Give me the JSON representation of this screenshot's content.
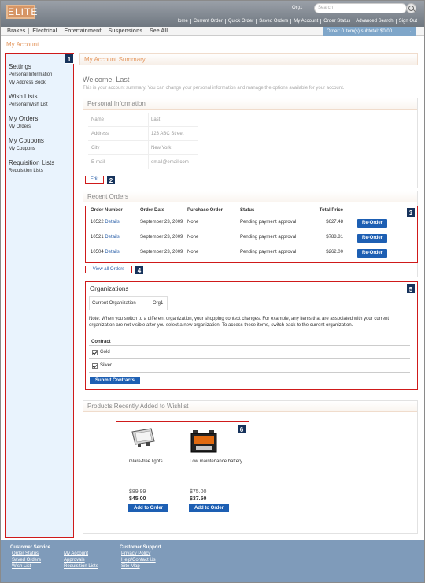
{
  "header": {
    "logo": "ELITE",
    "org": "Org1",
    "search_placeholder": "Search",
    "nav": [
      "Home",
      "Current Order",
      "Quick Order",
      "Saved Orders",
      "My Account",
      "Order Status",
      "Advanced Search",
      "Sign Out"
    ]
  },
  "catbar": {
    "categories": [
      "Brakes",
      "Electrical",
      "Entertainment",
      "Suspensions",
      "See All"
    ],
    "cart": "Order: 0 item(s) subtotal: $0.00"
  },
  "page_title": "My Account",
  "sidebar": {
    "groups": [
      {
        "title": "Settings",
        "items": [
          "Personal Information",
          "My Address Book"
        ]
      },
      {
        "title": "Wish Lists",
        "items": [
          "Personal Wish List"
        ]
      },
      {
        "title": "My Orders",
        "items": [
          "My Orders"
        ]
      },
      {
        "title": "My Coupons",
        "items": [
          "My Coupons"
        ]
      },
      {
        "title": "Requisition Lists",
        "items": [
          "Requisition Lists"
        ]
      }
    ]
  },
  "callouts": [
    "1",
    "2",
    "3",
    "4",
    "5",
    "6"
  ],
  "main": {
    "heading": "My Account Summary",
    "welcome": "Welcome, Last",
    "welcome_sub": "This is your account summary. You can change your personal information and manage the options available for your account."
  },
  "personal": {
    "title": "Personal Information",
    "rows": [
      {
        "k": "Name",
        "v": "Last"
      },
      {
        "k": "Address",
        "v": "123 ABC Street"
      },
      {
        "k": "City",
        "v": "New York"
      },
      {
        "k": "E-mail",
        "v": "email@email.com"
      }
    ],
    "edit": "Edit"
  },
  "orders": {
    "title": "Recent Orders",
    "headers": [
      "Order Number",
      "Order Date",
      "Purchase Order",
      "Status",
      "Total Price"
    ],
    "rows": [
      {
        "num": "10522",
        "date": "September 23, 2009",
        "po": "None",
        "status": "Pending payment approval",
        "total": "$627.48"
      },
      {
        "num": "10521",
        "date": "September 23, 2009",
        "po": "None",
        "status": "Pending payment approval",
        "total": "$788.81"
      },
      {
        "num": "10504",
        "date": "September 23, 2009",
        "po": "None",
        "status": "Pending payment approval",
        "total": "$262.00"
      }
    ],
    "details": "Details",
    "reorder": "Re-Order",
    "view_all": "View all Orders"
  },
  "orgs": {
    "title": "Organizations",
    "current_label": "Current Organization",
    "current_value": "Org1",
    "note": "Note: When you switch to a different organization, your shopping context changes. For example, any items that are associated with your current organization are not visible after you select a new organization. To access these items, switch back to the current organization.",
    "contract_header": "Contract",
    "contracts": [
      "Gold",
      "Silver"
    ],
    "submit": "Submit Contracts"
  },
  "wishlist": {
    "title": "Products Recently Added to Wishlist",
    "products": [
      {
        "name": "Glare-free lights",
        "old": "$89.99",
        "new": "$45.00"
      },
      {
        "name": "Low maintenance battery",
        "old": "$75.00",
        "new": "$37.50"
      }
    ],
    "add": "Add to Order"
  },
  "footer": {
    "cols": [
      {
        "title": "Customer Service",
        "links": [
          "Order Status",
          "Saved Orders",
          "Wish List"
        ]
      },
      {
        "title": "",
        "links": [
          "My Account",
          "Approvals",
          "Requisition Lists"
        ]
      },
      {
        "title": "Customer Support",
        "links": [
          "Privacy Policy",
          "Help/Contact Us",
          "Site Map"
        ]
      }
    ]
  }
}
